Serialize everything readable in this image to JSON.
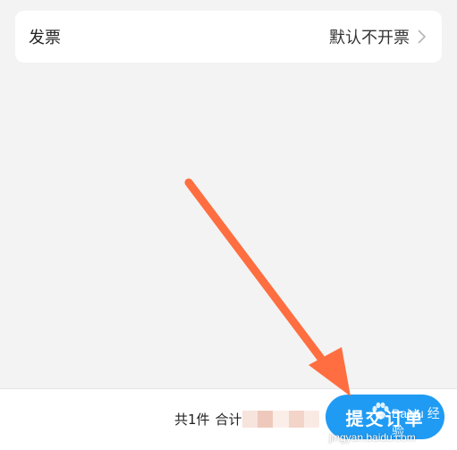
{
  "invoice": {
    "label": "发票",
    "value": "默认不开票",
    "chevron_icon": "chevron-right-icon"
  },
  "footer": {
    "count_text": "共1件",
    "total_label": "合计:",
    "submit_label": "提交订单"
  },
  "watermark": {
    "brand": "Baidu 经验",
    "url": "jingyan.baidu.com"
  },
  "colors": {
    "background": "#f3f3f3",
    "card": "#ffffff",
    "submit_button": "#1f9bf4",
    "annotation_arrow": "#ff6e40"
  }
}
